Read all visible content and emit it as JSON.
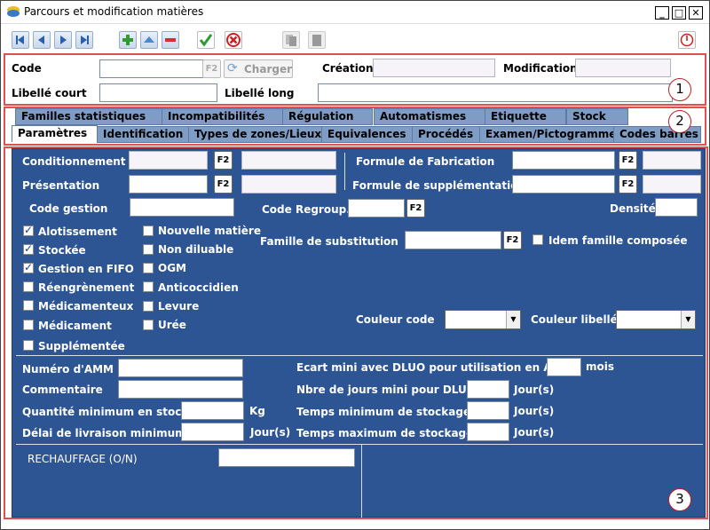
{
  "window": {
    "title": "Parcours et modification matières"
  },
  "toolbar": {
    "charger_label": "Charger"
  },
  "header": {
    "code_label": "Code",
    "f2": "F2",
    "creation_label": "Création",
    "modification_label": "Modification",
    "libelle_court_label": "Libellé court",
    "libelle_long_label": "Libellé long",
    "marker": "1"
  },
  "tabs": {
    "marker": "2",
    "row1": [
      "Familles statistiques",
      "Incompatibilités",
      "Régulation",
      "Automatismes",
      "Etiquette",
      "Stock"
    ],
    "row2": [
      "Paramètres",
      "Identification",
      "Types de zones/Lieux",
      "Equivalences",
      "Procédés",
      "Examen/Pictogramme",
      "Codes barres"
    ]
  },
  "panel": {
    "marker": "3",
    "conditionnement": "Conditionnement",
    "presentation": "Présentation",
    "code_gestion": "Code gestion",
    "formule_fab": "Formule de Fabrication",
    "formule_sup": "Formule de supplémentation",
    "code_regroup": "Code Regroup.",
    "densite": "Densité",
    "famille_sub": "Famille de substitution",
    "idem_famille": "Idem famille composée",
    "couleur_code": "Couleur code",
    "couleur_libelle": "Couleur libellé",
    "checks_left": [
      {
        "label": "Alotissement",
        "checked": true
      },
      {
        "label": "Stockée",
        "checked": true
      },
      {
        "label": "Gestion en FIFO",
        "checked": true
      },
      {
        "label": "Réengrènement",
        "checked": false
      },
      {
        "label": "Médicamenteux",
        "checked": false
      },
      {
        "label": "Médicament",
        "checked": false
      },
      {
        "label": "Supplémentée",
        "checked": false
      }
    ],
    "checks_right": [
      {
        "label": "Nouvelle matière",
        "checked": false
      },
      {
        "label": "Non diluable",
        "checked": false
      },
      {
        "label": "OGM",
        "checked": false
      },
      {
        "label": "Anticoccidien",
        "checked": false
      },
      {
        "label": "Levure",
        "checked": false
      },
      {
        "label": "Urée",
        "checked": false
      }
    ],
    "numero_amm": "Numéro d'AMM",
    "commentaire": "Commentaire",
    "qte_min": "Quantité minimum en stock",
    "kg": "Kg",
    "delai": "Délai de livraison minimum",
    "jours_s": "Jour(s)",
    "ecart": "Ecart mini avec DLUO pour utilisation en ADD",
    "mois": "mois",
    "nbre_jours": "Nbre de jours mini pour DLUO",
    "temps_min": "Temps minimum de stockage",
    "temps_max": "Temps maximum de stockage",
    "jours": "Jour(s)",
    "rechauffage": "RECHAUFFAGE (O/N)"
  }
}
